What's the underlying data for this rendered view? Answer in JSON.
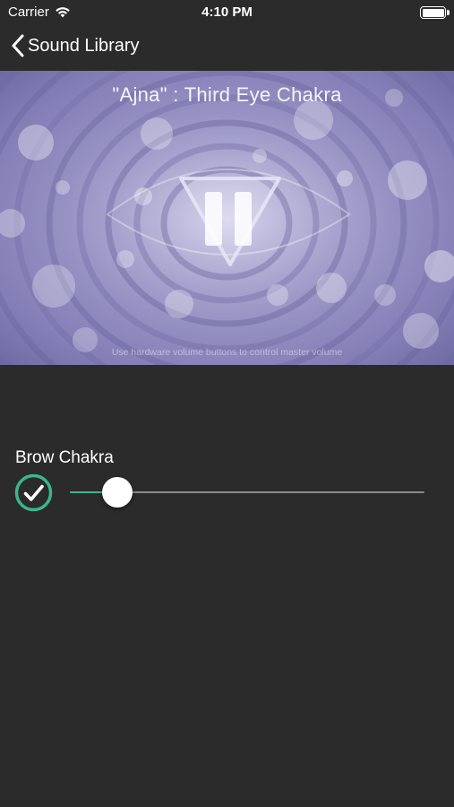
{
  "status_bar": {
    "carrier": "Carrier",
    "time": "4:10 PM",
    "wifi_icon": "wifi-icon",
    "battery_icon": "battery-icon"
  },
  "nav": {
    "back_label": "Sound Library",
    "back_icon": "chevron-left-icon"
  },
  "player": {
    "title": "\"Ajna\" : Third Eye Chakra",
    "hint": "Use hardware volume buttons to control master volume",
    "pause_icon": "pause-icon",
    "accent_color": "#8c86bd"
  },
  "channel": {
    "label": "Brow Chakra",
    "enabled": true,
    "check_icon": "checkmark-icon",
    "volume_fraction": 0.1,
    "accent_color": "#3bb68c"
  }
}
